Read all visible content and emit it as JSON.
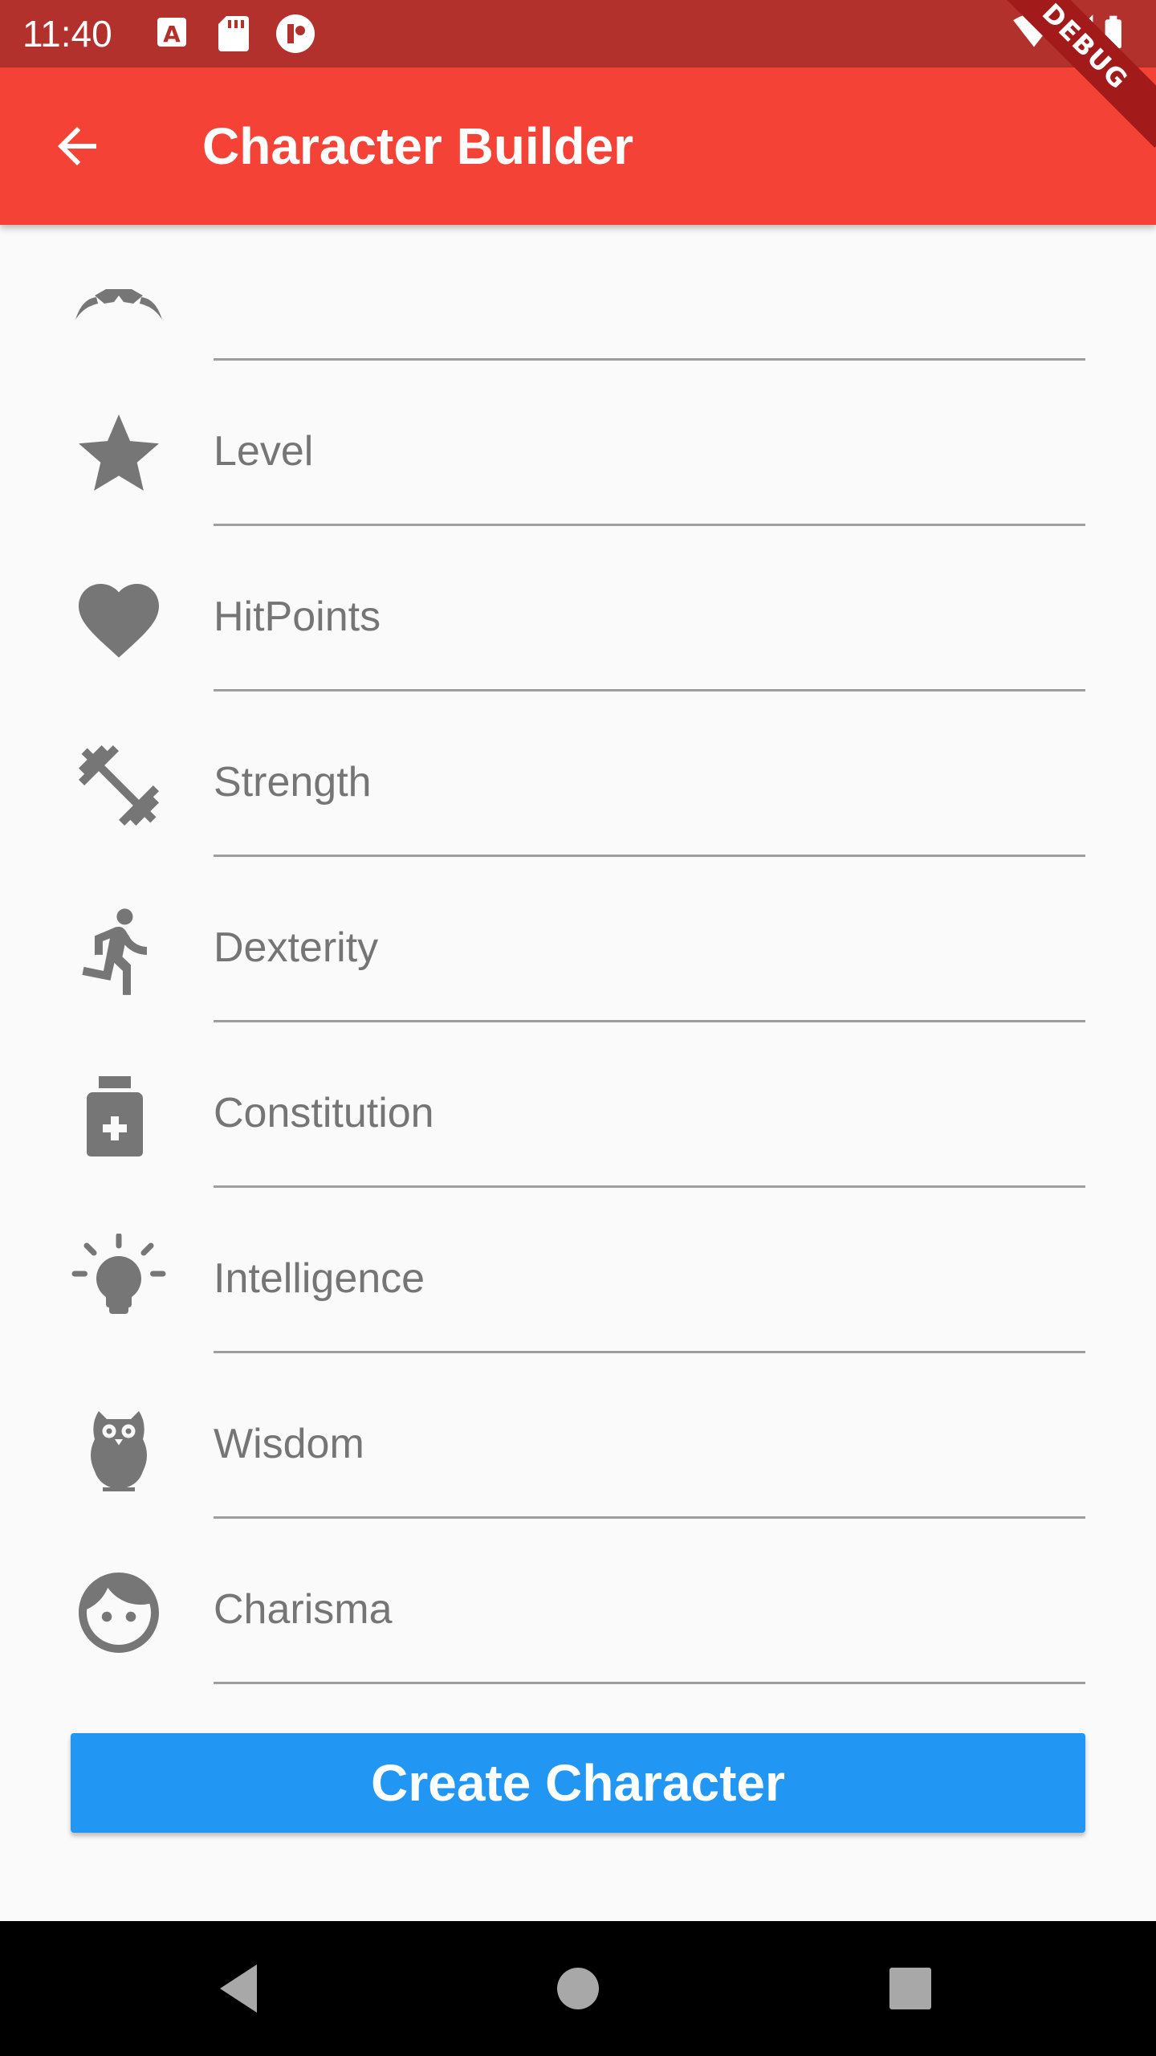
{
  "status_bar": {
    "time": "11:40",
    "left_icons": [
      "a-text-icon",
      "sd-card-icon",
      "notification-badge-icon"
    ],
    "right_icons": [
      "wifi-icon",
      "cell-signal-icon",
      "battery-icon"
    ]
  },
  "app_bar": {
    "title": "Character Builder",
    "back_icon": "arrow-back-icon",
    "color": "#f44336"
  },
  "debug_banner": "DEBUG",
  "fields": [
    {
      "icon": "mask-icon",
      "placeholder": "",
      "value": ""
    },
    {
      "icon": "star-icon",
      "placeholder": "Level",
      "value": ""
    },
    {
      "icon": "heart-icon",
      "placeholder": "HitPoints",
      "value": ""
    },
    {
      "icon": "dumbbell-icon",
      "placeholder": "Strength",
      "value": ""
    },
    {
      "icon": "running-icon",
      "placeholder": "Dexterity",
      "value": ""
    },
    {
      "icon": "medicine-bottle-icon",
      "placeholder": "Constitution",
      "value": ""
    },
    {
      "icon": "lightbulb-icon",
      "placeholder": "Intelligence",
      "value": ""
    },
    {
      "icon": "owl-icon",
      "placeholder": "Wisdom",
      "value": ""
    },
    {
      "icon": "face-icon",
      "placeholder": "Charisma",
      "value": ""
    }
  ],
  "create_button": {
    "label": "Create Character",
    "color": "#2196f3"
  },
  "nav_bar": {
    "icons": [
      "back-triangle-icon",
      "home-circle-icon",
      "recents-square-icon"
    ]
  }
}
